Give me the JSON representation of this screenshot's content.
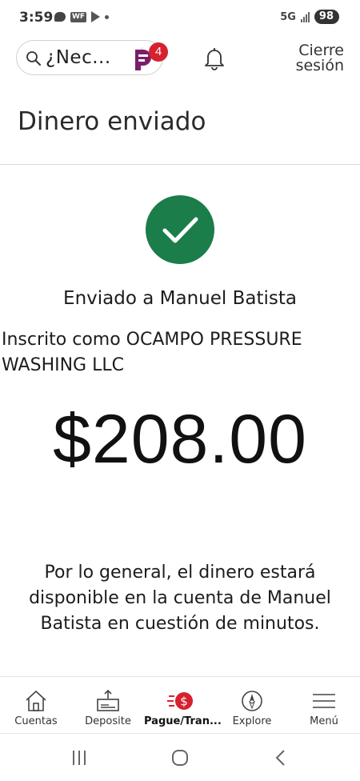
{
  "status_bar": {
    "time": "3:59",
    "network": "5G",
    "battery": "98"
  },
  "header": {
    "search_placeholder": "¿Nec...",
    "erica_badge_count": "4",
    "logout_line1": "Cierre",
    "logout_line2": "sesión"
  },
  "page": {
    "title": "Dinero enviado"
  },
  "confirmation": {
    "recipient_line": "Enviado a Manuel Batista",
    "enrolled_line": "Inscrito como OCAMPO PRESSURE WASHING LLC",
    "amount": "$208.00",
    "availability_note": "Por lo general, el dinero estará disponible en la cuenta de Manuel Batista en cuestión de minutos."
  },
  "bottom_nav": {
    "items": [
      {
        "label": "Cuentas",
        "icon": "house-icon"
      },
      {
        "label": "Deposite",
        "icon": "deposit-check-icon"
      },
      {
        "label": "Pague/Tran...",
        "icon": "pay-transfer-icon"
      },
      {
        "label": "Explore",
        "icon": "compass-icon"
      },
      {
        "label": "Menú",
        "icon": "hamburger-menu-icon"
      }
    ],
    "active_index": 2
  },
  "colors": {
    "success_green": "#1b7d4a",
    "brand_red": "#d6212f",
    "erica_purple": "#7a1e6b"
  }
}
